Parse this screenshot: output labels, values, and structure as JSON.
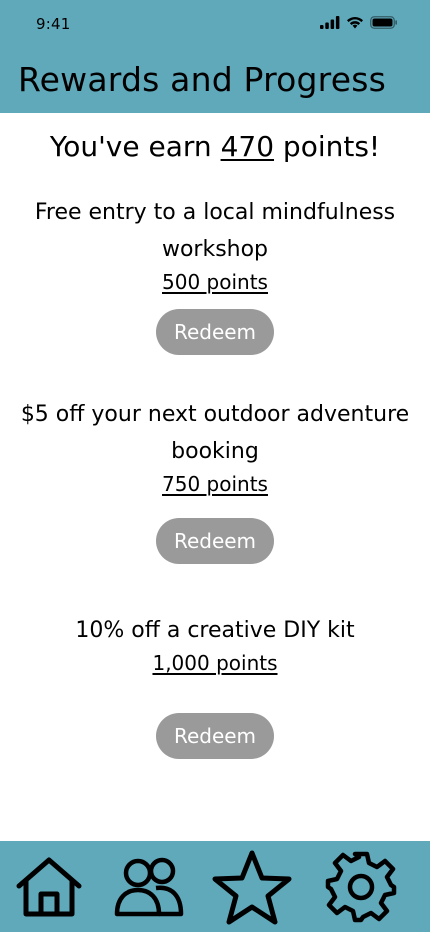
{
  "status_bar": {
    "time": "9:41"
  },
  "header": {
    "title": "Rewards and Progress"
  },
  "points": {
    "prefix": "You've earn ",
    "value": "470",
    "suffix": " points!"
  },
  "rewards": [
    {
      "title": "Free entry to a local mindfulness workshop",
      "cost": "500 points",
      "button": "Redeem"
    },
    {
      "title": "$5 off your next outdoor adventure booking",
      "cost": "750 points",
      "button": "Redeem"
    },
    {
      "title": "10% off a creative DIY kit",
      "cost": "1,000 points",
      "button": "Redeem"
    }
  ],
  "tab_bar": {
    "icons": [
      "home-icon",
      "people-icon",
      "star-icon",
      "gear-icon"
    ]
  },
  "colors": {
    "header_bg": "#5fa9bb",
    "button_bg": "#9a9a9a",
    "button_text": "#ffffff"
  }
}
